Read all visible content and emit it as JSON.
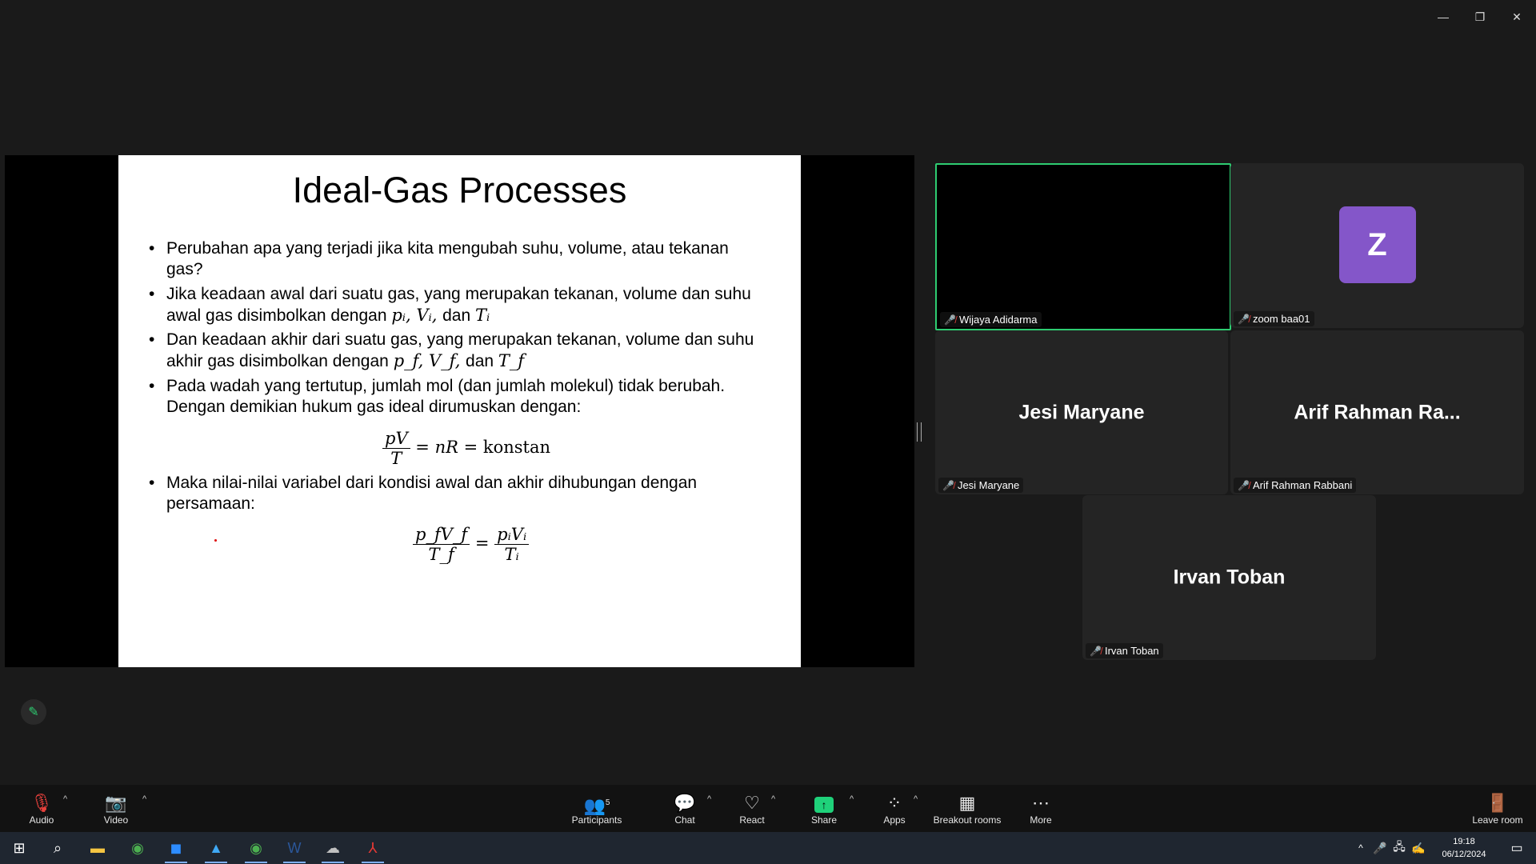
{
  "window_controls": {
    "minimize": "—",
    "restore": "❐",
    "close": "✕"
  },
  "slide": {
    "title": "Ideal-Gas Processes",
    "bullets": [
      {
        "lines": [
          "Perubahan apa yang terjadi jika kita mengubah suhu, volume, atau tekanan",
          "gas?"
        ]
      },
      {
        "line1": "Jika keadaan awal dari suatu gas, yang merupakan tekanan, volume dan suhu",
        "line2_prefix": "awal gas disimbolkan dengan ",
        "line2_math": "pᵢ, Vᵢ, ",
        "line2_and": "dan ",
        "line2_math2": "Tᵢ"
      },
      {
        "line1": "Dan keadaan akhir dari suatu gas, yang merupakan tekanan, volume dan suhu",
        "line2_prefix": "akhir gas disimbolkan dengan ",
        "line2_math": "p_f, V_f, ",
        "line2_and": "dan ",
        "line2_math2": "T_f"
      },
      {
        "lines": [
          "Pada wadah yang tertutup, jumlah mol (dan jumlah molekul) tidak berubah.",
          "Dengan demikian hukum gas ideal dirumuskan dengan:"
        ]
      },
      {
        "lines": [
          "Maka nilai-nilai variabel dari kondisi awal dan akhir dihubungan dengan",
          "persamaan:"
        ]
      }
    ],
    "eq1": {
      "num": "pV",
      "den": "T",
      "rhs": "= nR = ",
      "konstan": "konstan"
    },
    "eq2": {
      "lnum": "p_fV_f",
      "lden": "T_f",
      "eq": "=",
      "rnum": "pᵢVᵢ",
      "rden": "Tᵢ"
    }
  },
  "participants_tiles": [
    {
      "name": "Wijaya Adidarma",
      "muted": true,
      "active_speaker": true
    },
    {
      "name": "zoom baa01",
      "muted": true,
      "avatar_letter": "Z"
    },
    {
      "name": "Jesi Maryane",
      "display": "Jesi Maryane",
      "muted": true
    },
    {
      "name": "Arif Rahman Rabbani",
      "display": "Arif Rahman Ra...",
      "muted": true
    },
    {
      "name": "Irvan Toban",
      "display": "Irvan Toban",
      "muted": true
    }
  ],
  "toolbar": {
    "audio": "Audio",
    "video": "Video",
    "participants": "Participants",
    "participants_count": "5",
    "chat": "Chat",
    "react": "React",
    "share": "Share",
    "apps": "Apps",
    "breakout": "Breakout rooms",
    "more": "More",
    "leave": "Leave room"
  },
  "taskbar": {
    "time": "19:18",
    "date": "06/12/2024"
  },
  "colors": {
    "active_speaker": "#2ecc71",
    "share_green": "#1fd17a",
    "muted_red": "#e8413c",
    "avatar": "#8456c9"
  }
}
